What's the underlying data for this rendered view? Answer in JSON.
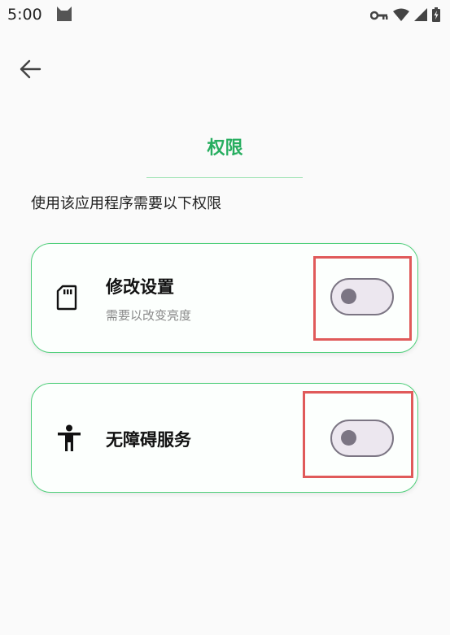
{
  "status_bar": {
    "time": "5:00"
  },
  "page": {
    "title": "权限",
    "subtitle": "使用该应用程序需要以下权限",
    "accent_color": "#27ae60"
  },
  "permissions": [
    {
      "icon": "sd-card-icon",
      "title": "修改设置",
      "description": "需要以改变亮度",
      "enabled": false
    },
    {
      "icon": "accessibility-icon",
      "title": "无障碍服务",
      "enabled": false
    }
  ],
  "highlight_color": "#e05a5a"
}
